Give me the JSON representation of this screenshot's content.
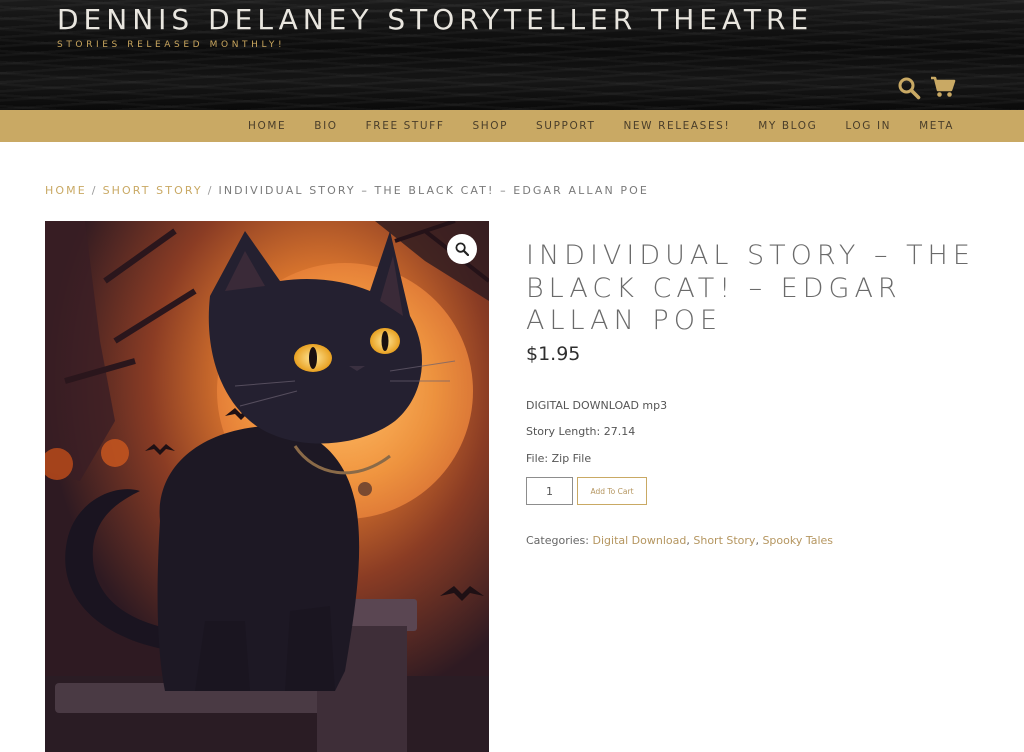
{
  "header": {
    "site_title": "DENNIS DELANEY STORYTELLER THEATRE",
    "tagline": "STORIES RELEASED MONTHLY!"
  },
  "nav": {
    "items": [
      "HOME",
      "BIO",
      "FREE STUFF",
      "SHOP",
      "SUPPORT",
      "NEW RELEASES!",
      "MY BLOG",
      "LOG IN",
      "META"
    ]
  },
  "breadcrumb": {
    "home": "HOME",
    "category": "SHORT STORY",
    "current": "INDIVIDUAL STORY – THE BLACK CAT! – EDGAR ALLAN POE",
    "separator": "/"
  },
  "product": {
    "title": "INDIVIDUAL STORY – THE BLACK CAT! – EDGAR ALLAN POE",
    "price": "$1.95",
    "description": [
      "DIGITAL DOWNLOAD mp3",
      "Story Length: 27.14",
      "File: Zip File"
    ],
    "quantity": "1",
    "add_to_cart": "Add To Cart",
    "categories_label": "Categories:",
    "categories": [
      "Digital Download",
      "Short Story",
      "Spooky Tales"
    ],
    "image_icon": "black-cat-illustration",
    "zoom_icon": "magnifier-zoom-icon"
  },
  "colors": {
    "accent": "#c9a964",
    "header_bg": "#111111",
    "title_text": "#e9e6df"
  }
}
